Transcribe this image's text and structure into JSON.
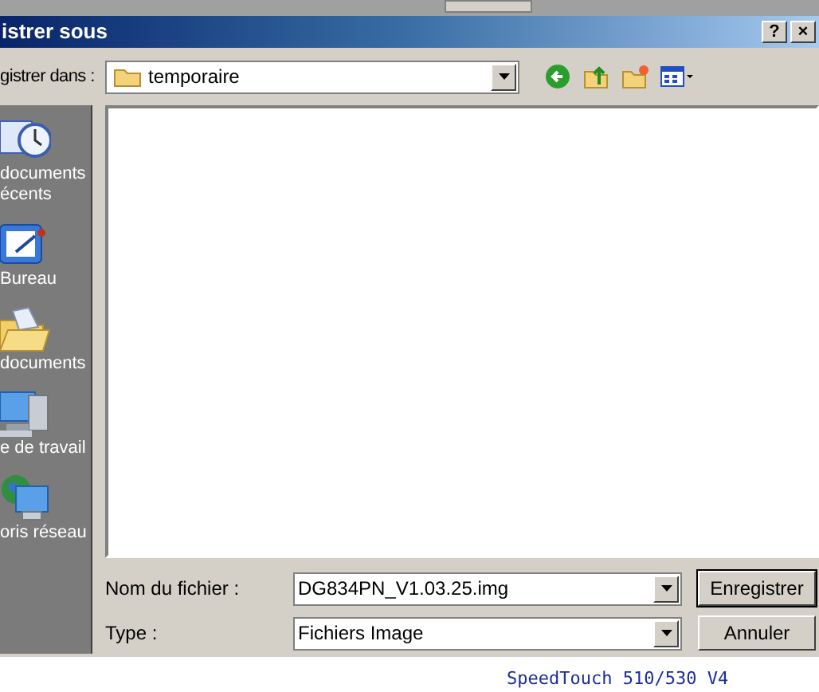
{
  "window": {
    "title": "istrer sous",
    "buttons": [
      "?",
      "×"
    ]
  },
  "save_in": {
    "label": "gistrer dans :",
    "value": "temporaire"
  },
  "places": [
    {
      "label": "documents\nécents",
      "kind": "recent"
    },
    {
      "label": "Bureau",
      "kind": "desktop"
    },
    {
      "label": "documents",
      "kind": "documents"
    },
    {
      "label": "e de travail",
      "kind": "computer"
    },
    {
      "label": "oris réseau",
      "kind": "network"
    }
  ],
  "file_name": {
    "label": "Nom du fichier :",
    "value": "DG834PN_V1.03.25.img"
  },
  "file_type": {
    "label": "Type :",
    "value": "Fichiers Image"
  },
  "buttons": [
    "Enregistrer",
    "Annuler"
  ],
  "background_text": "SpeedTouch 510/530 V4"
}
